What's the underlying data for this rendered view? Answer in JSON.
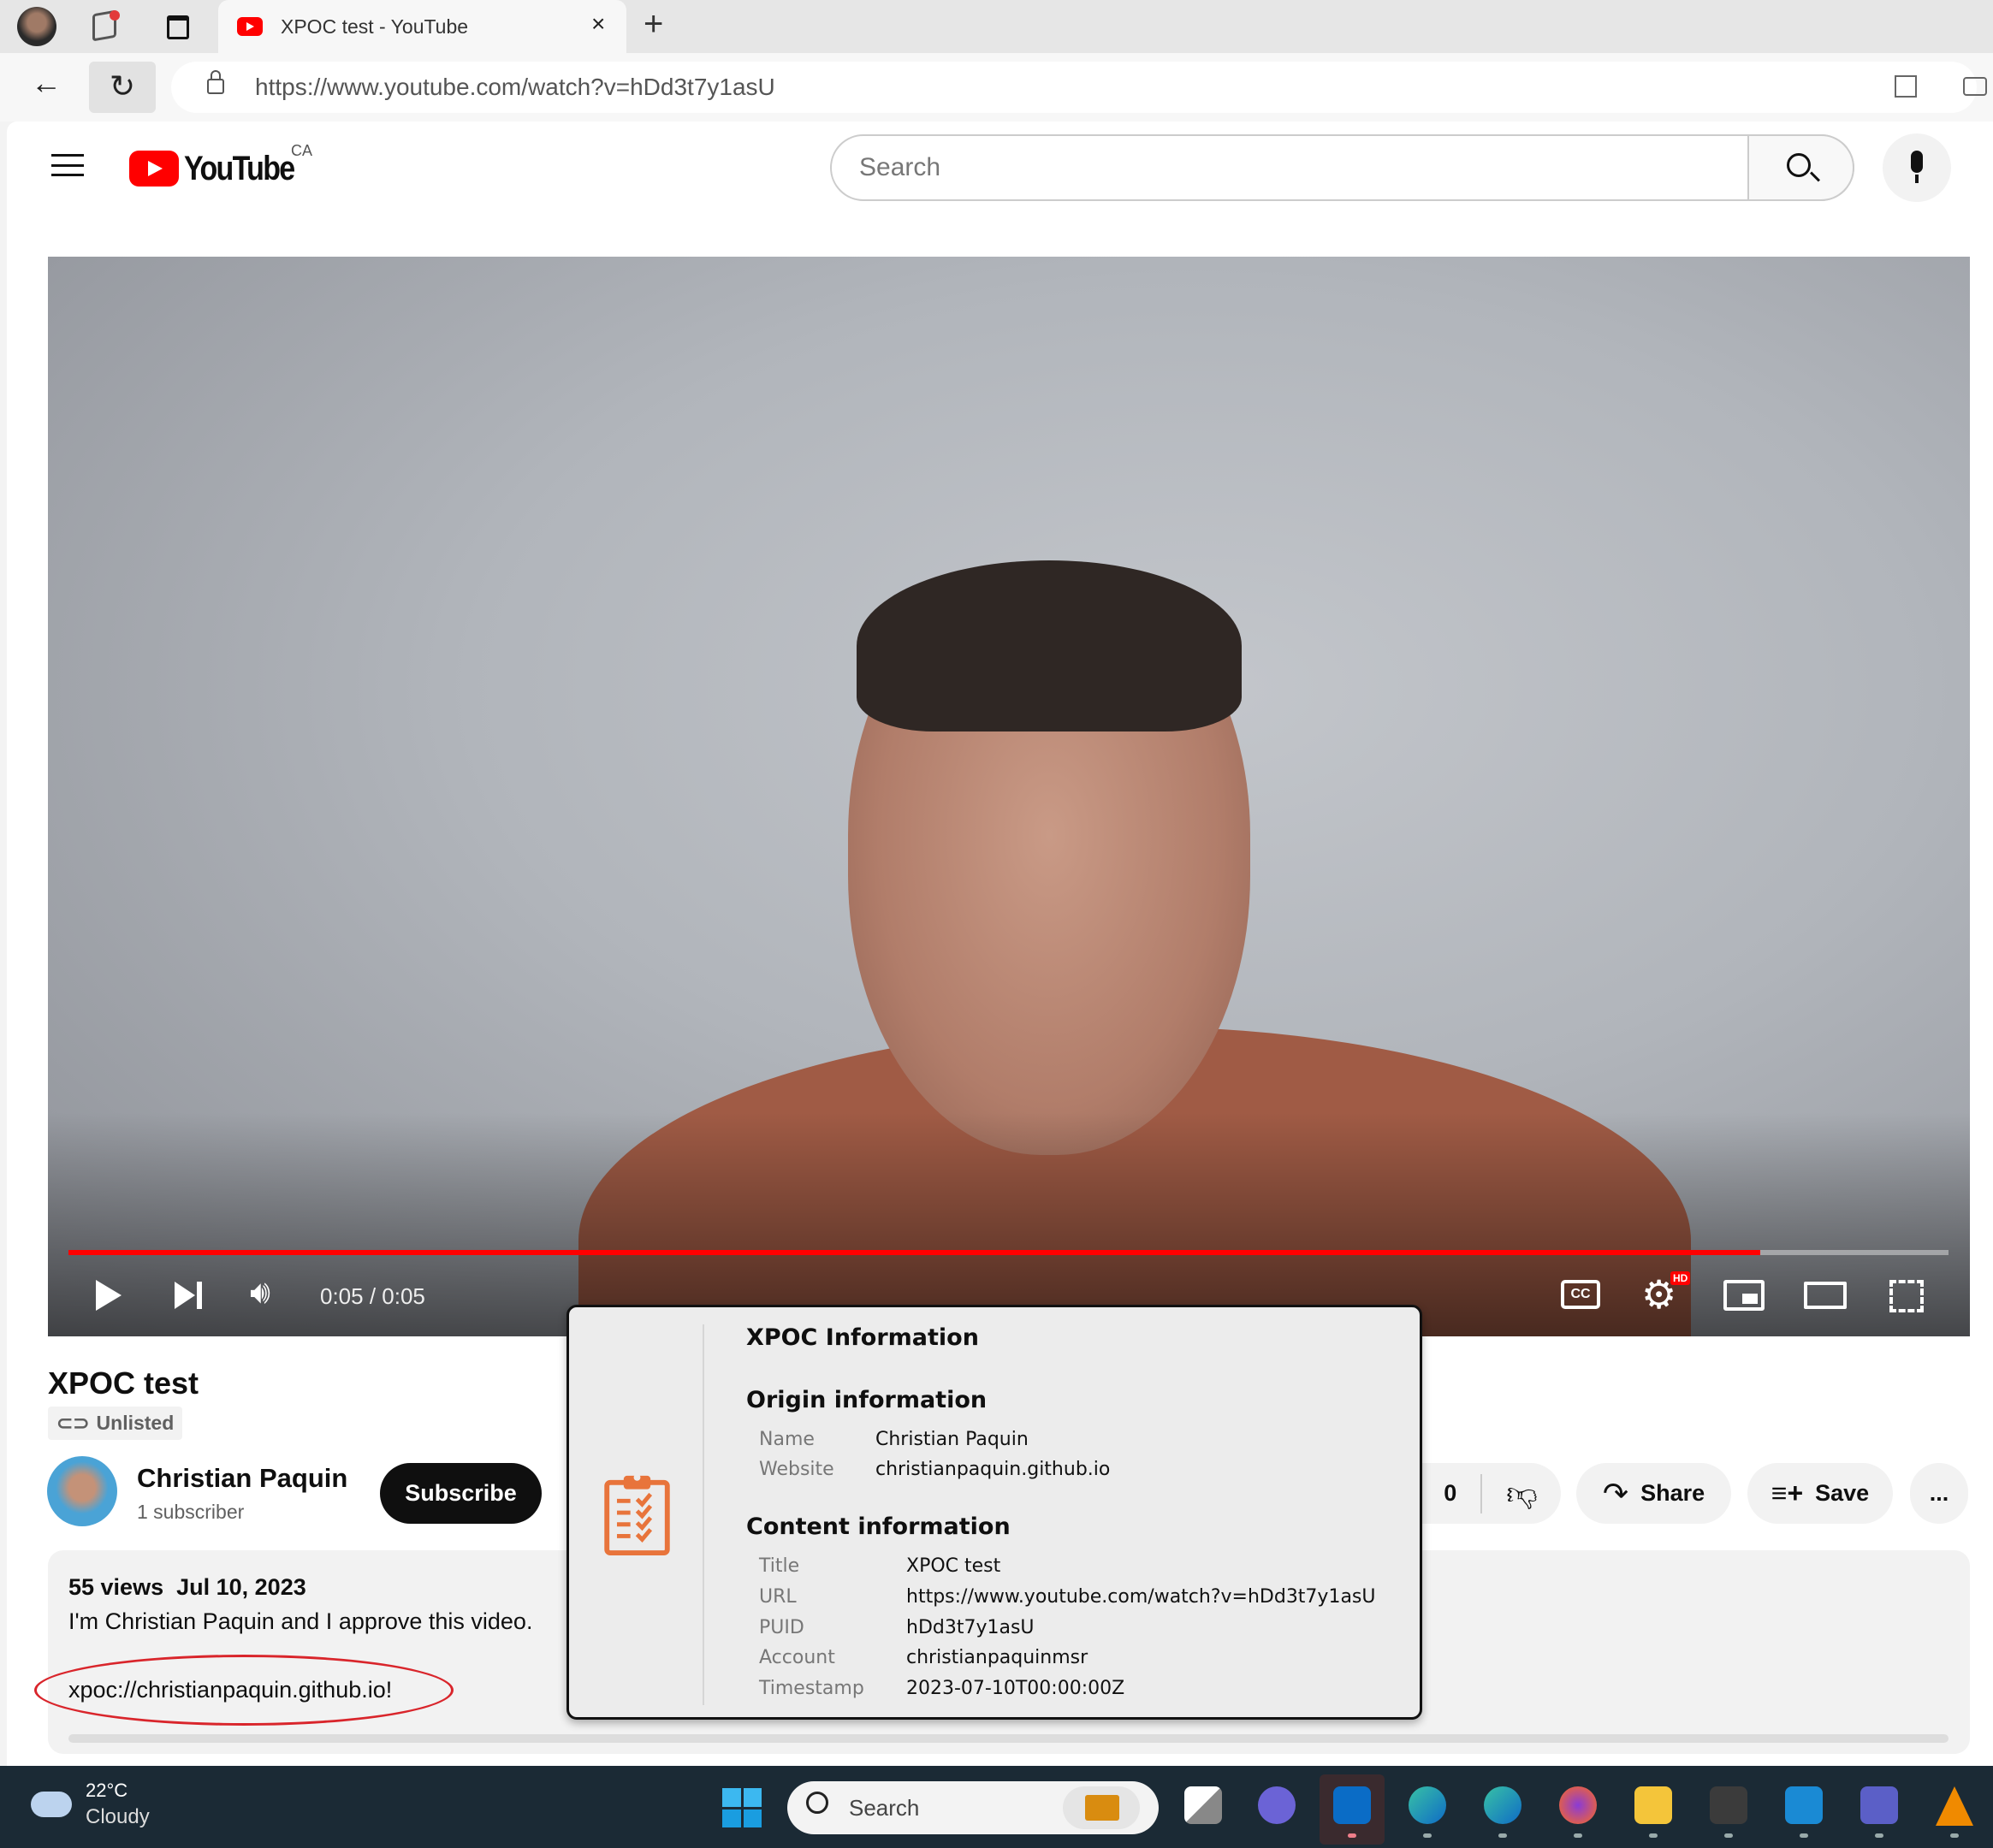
{
  "browser": {
    "tab_title": "XPOC test - YouTube",
    "url": "https://www.youtube.com/watch?v=hDd3t7y1asU"
  },
  "header": {
    "logo_text": "YouTube",
    "region": "CA",
    "search_placeholder": "Search"
  },
  "player": {
    "time": "0:05 / 0:05",
    "progress_percent": 90,
    "hd_badge": "HD"
  },
  "video": {
    "title": "XPOC test",
    "visibility": "Unlisted",
    "channel": "Christian Paquin",
    "subscribers": "1 subscriber",
    "subscribe_label": "Subscribe",
    "like_count": "0",
    "share_label": "Share",
    "save_label": "Save",
    "more_label": "...",
    "views": "55 views",
    "date": "Jul 10, 2023",
    "description": "I'm Christian Paquin and I approve this video.",
    "xpoc_link": "xpoc://christianpaquin.github.io!"
  },
  "xpoc": {
    "title": "XPOC Information",
    "origin": {
      "heading": "Origin information",
      "rows": [
        {
          "label": "Name",
          "value": "Christian Paquin"
        },
        {
          "label": "Website",
          "value": "christianpaquin.github.io"
        }
      ]
    },
    "content": {
      "heading": "Content information",
      "rows": [
        {
          "label": "Title",
          "value": "XPOC test"
        },
        {
          "label": "URL",
          "value": "https://www.youtube.com/watch?v=hDd3t7y1asU"
        },
        {
          "label": "PUID",
          "value": "hDd3t7y1asU"
        },
        {
          "label": "Account",
          "value": "christianpaquinmsr"
        },
        {
          "label": "Timestamp",
          "value": "2023-07-10T00:00:00Z"
        }
      ]
    },
    "icon_color": "#e8743b"
  },
  "taskbar": {
    "temperature": "22°C",
    "weather": "Cloudy",
    "search_placeholder": "Search"
  },
  "colors": {
    "youtube_red": "#ff0000",
    "annotation_red": "#d9252b"
  }
}
